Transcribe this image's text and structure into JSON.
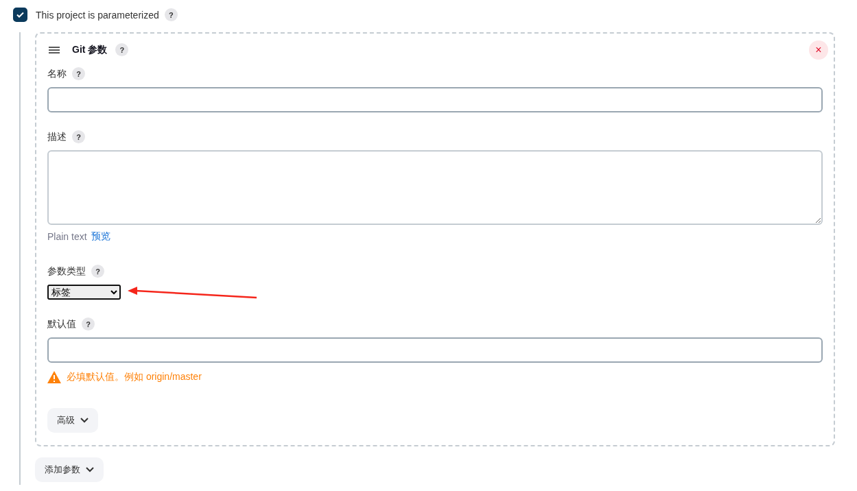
{
  "parameterized": {
    "checked": true,
    "label": "This project is parameterized",
    "help": "?"
  },
  "parameter": {
    "title": "Git 参数",
    "help": "?",
    "close": "×",
    "fields": [
      {
        "kind": "input",
        "label": "名称",
        "help": "?"
      },
      {
        "kind": "textarea",
        "label": "描述",
        "help": "?",
        "format": "Plain text",
        "preview": "预览"
      },
      {
        "kind": "select",
        "label": "参数类型",
        "help": "?",
        "value": "标签"
      },
      {
        "kind": "input",
        "label": "默认值",
        "help": "?",
        "warning": "必填默认值。例如 origin/master"
      }
    ],
    "advanced": "高级"
  },
  "add_button": "添加参数"
}
